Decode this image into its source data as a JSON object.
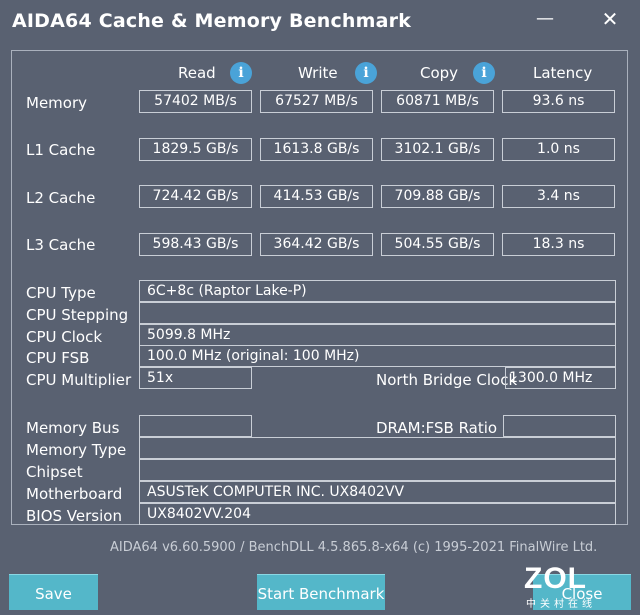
{
  "window": {
    "title": "AIDA64 Cache & Memory Benchmark",
    "minimize_glyph": "—",
    "close_glyph": "✕"
  },
  "columns": {
    "read": "Read",
    "write": "Write",
    "copy": "Copy",
    "latency": "Latency",
    "info_glyph": "i"
  },
  "rows": [
    {
      "label": "Memory",
      "read": "57402 MB/s",
      "write": "67527 MB/s",
      "copy": "60871 MB/s",
      "latency": "93.6 ns"
    },
    {
      "label": "L1 Cache",
      "read": "1829.5 GB/s",
      "write": "1613.8 GB/s",
      "copy": "3102.1 GB/s",
      "latency": "1.0 ns"
    },
    {
      "label": "L2 Cache",
      "read": "724.42 GB/s",
      "write": "414.53 GB/s",
      "copy": "709.88 GB/s",
      "latency": "3.4 ns"
    },
    {
      "label": "L3 Cache",
      "read": "598.43 GB/s",
      "write": "364.42 GB/s",
      "copy": "504.55 GB/s",
      "latency": "18.3 ns"
    }
  ],
  "cpu": {
    "type_label": "CPU Type",
    "type_value": "6C+8c   (Raptor Lake-P)",
    "stepping_label": "CPU Stepping",
    "stepping_value": "",
    "clock_label": "CPU Clock",
    "clock_value": "5099.8 MHz",
    "fsb_label": "CPU FSB",
    "fsb_value": "100.0 MHz  (original: 100 MHz)",
    "multiplier_label": "CPU Multiplier",
    "multiplier_value": "51x",
    "nb_clock_label": "North Bridge Clock",
    "nb_clock_value": "1300.0 MHz"
  },
  "memory": {
    "bus_label": "Memory Bus",
    "bus_value": "",
    "dram_ratio_label": "DRAM:FSB Ratio",
    "dram_ratio_value": "",
    "type_label": "Memory Type",
    "type_value": "",
    "chipset_label": "Chipset",
    "chipset_value": "",
    "motherboard_label": "Motherboard",
    "motherboard_value": "ASUSTeK COMPUTER INC. UX8402VV",
    "bios_label": "BIOS Version",
    "bios_value": "UX8402VV.204"
  },
  "footer": {
    "version_text": "AIDA64 v6.60.5900 / BenchDLL 4.5.865.8-x64  (c) 1995-2021 FinalWire Ltd."
  },
  "buttons": {
    "save": "Save",
    "start": "Start Benchmark",
    "close": "Close"
  },
  "watermark": {
    "logo": "ZOL",
    "sub": "中关村在线"
  }
}
